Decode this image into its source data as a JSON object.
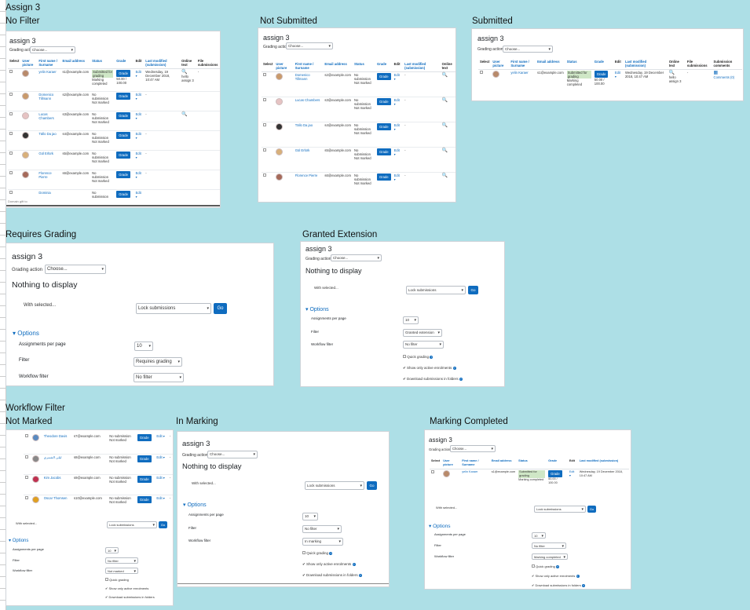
{
  "labels": {
    "assign3": "Assign 3",
    "nofilter": "No Filter",
    "notsubmitted": "Not Submitted",
    "submitted": "Submitted",
    "reqgrading": "Requires Grading",
    "granted": "Granted Extension",
    "wffilter": "Workflow Filter",
    "notmarked": "Not Marked",
    "inmarking": "In Marking",
    "markcompleted": "Marking Completed"
  },
  "common": {
    "title": "assign 3",
    "grading_action": "Grading action",
    "choose": "Choose...",
    "nothing": "Nothing to display",
    "with_selected": "With selected...",
    "lock": "Lock submissions",
    "go": "Go",
    "options": "Options",
    "app": "Assignments per page",
    "app_val": "10",
    "filter": "Filter",
    "workflow": "Workflow filter",
    "quick": "Quick grading",
    "active": "Show only active enrolments",
    "download": "Download submissions in folders",
    "grade_btn": "Grade",
    "edit": "Edit"
  },
  "headers": {
    "select": "Select",
    "userpic": "User picture",
    "name": "First name / Surname",
    "email": "Email address",
    "status": "Status",
    "grade": "Grade",
    "edit": "Edit",
    "lastmod": "Last modified (submission)",
    "online": "Online text",
    "files": "File submissions",
    "comments": "Submission comments"
  },
  "rows": {
    "p1": {
      "name": "yelin Karaer",
      "email": "s1@example.com",
      "st1": "Submitted for grading",
      "st2": "Marking completed",
      "grade": "50.00 / 100.00",
      "lastmod": "Wednesday, 19 December 2018, 10:47 AM",
      "online": "hello assign 3"
    },
    "p2": {
      "name": "Domenico Tillmann",
      "email": "s2@example.com"
    },
    "p3": {
      "name": "Lucas Chambers",
      "email": "s3@example.com"
    },
    "p4": {
      "name": "Tällo Da jao",
      "email": "s4@example.com"
    },
    "p5": {
      "name": "Gül Erlürk",
      "email": "s5@example.com"
    },
    "p6": {
      "name": "Florence Pierre",
      "email": "s6@example.com"
    },
    "p7": {
      "name": "Theodore Davis",
      "email": "s7@example.com"
    },
    "p8": {
      "name": "ليلى الشمري",
      "email": "s8@example.com"
    },
    "p9": {
      "name": "Kim Jacobs",
      "email": "s9@example.com"
    },
    "p10": {
      "name": "Oscar Thomsen",
      "email": "s10@example.com"
    },
    "ns1": "No submission",
    "ns2": "Not marked",
    "dash": "-",
    "comments": "Comments (0)",
    "cut": "Dominia",
    "scroll": "Domain gift to"
  },
  "filters": {
    "reqgrading": "Requires grading",
    "nofilter": "No filter",
    "granted": "Granted extension",
    "notmarked": "Not marked",
    "inmarking": "In marking",
    "completed": "Marking completed"
  },
  "colors": {
    "accent": "#0f6cbf",
    "bg": "#addfe6",
    "submitted": "#cfe7c6"
  }
}
